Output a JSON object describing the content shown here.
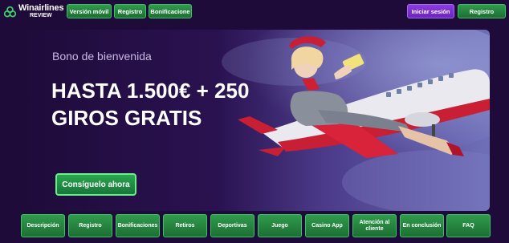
{
  "logo": {
    "name": "Winairlines",
    "sub": "REVIEW"
  },
  "header_nav": [
    {
      "label": "Versión móvil"
    },
    {
      "label": "Registro"
    },
    {
      "label": "Bonificacione"
    }
  ],
  "auth": {
    "login_label": "Iniciar sesión",
    "register_label": "Registro"
  },
  "hero": {
    "subtitle": "Bono de bienvenida",
    "title": "HASTA 1.500€ + 250 GIROS GRATIS",
    "cta_label": "Consíguelo ahora"
  },
  "bottom_nav": [
    {
      "label": "Descripción"
    },
    {
      "label": "Registro"
    },
    {
      "label": "Bonificaciones"
    },
    {
      "label": "Retiros"
    },
    {
      "label": "Deportivas"
    },
    {
      "label": "Juego"
    },
    {
      "label": "Casino App"
    },
    {
      "label": "Atención al cliente"
    },
    {
      "label": "En conclusión"
    },
    {
      "label": "FAQ"
    }
  ],
  "colors": {
    "background": "#1f0b3a",
    "accent_green": "#2f9c4c",
    "accent_purple": "#8c3ee0"
  }
}
